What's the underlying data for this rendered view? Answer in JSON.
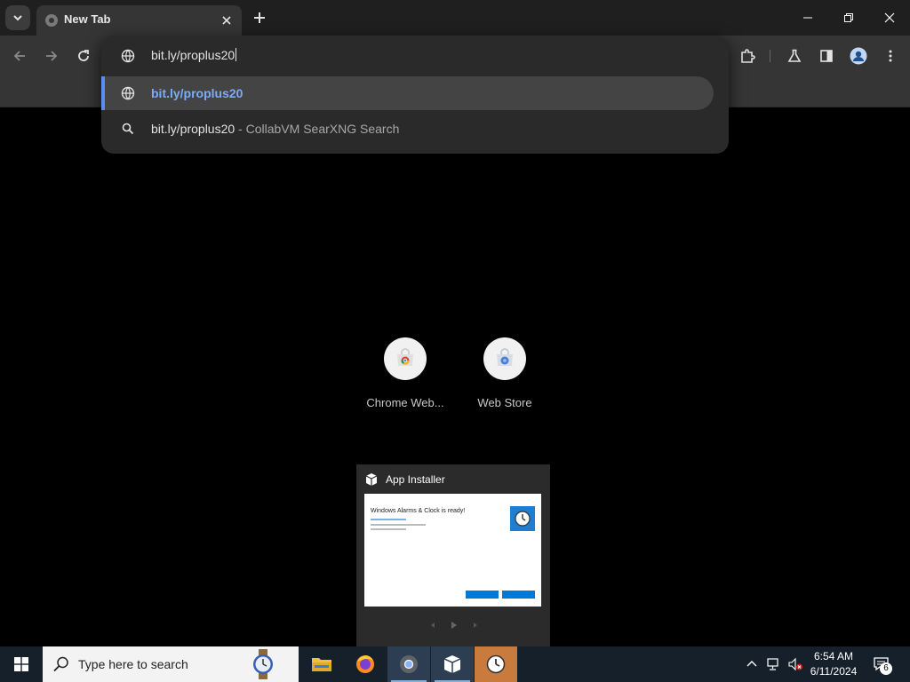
{
  "browser": {
    "tab": {
      "title": "New Tab"
    },
    "omnibox": {
      "value": "bit.ly/proplus20",
      "suggestions": [
        {
          "text": "bit.ly/proplus20"
        },
        {
          "text": "bit.ly/proplus20",
          "suffix": " - CollabVM SearXNG Search"
        }
      ]
    },
    "shortcuts": [
      {
        "label": "Chrome Web..."
      },
      {
        "label": "Web Store"
      }
    ],
    "accent": "#7cacf8"
  },
  "thumbnail": {
    "title": "App Installer",
    "preview_title": "Windows Alarms & Clock is ready!"
  },
  "taskbar": {
    "search_placeholder": "Type here to search",
    "time": "6:54 AM",
    "date": "6/11/2024",
    "notification_count": "6"
  }
}
